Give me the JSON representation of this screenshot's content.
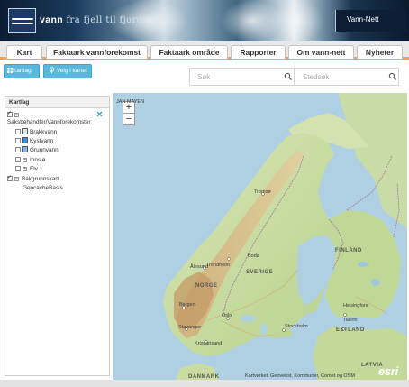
{
  "header": {
    "logo_text_bold": "vann",
    "logo_text_light": "fra fjell til fjord",
    "app_name": "Vann-Nett"
  },
  "tabs": [
    {
      "label": "Kart"
    },
    {
      "label": "Faktaark vannforekomst"
    },
    {
      "label": "Faktaark område"
    },
    {
      "label": "Rapporter"
    },
    {
      "label": "Om vann-nett"
    },
    {
      "label": "Nyheter"
    }
  ],
  "toolbar": {
    "kartlag_label": "Kartlag",
    "velg_label": "Velg i kartet",
    "search_placeholder": "Søk",
    "place_search_placeholder": "Stedsøk"
  },
  "layer_panel": {
    "title": "Kartlag",
    "group_label": "Saksbehandler/Vannforekomster",
    "items": [
      {
        "label": "Brakkvann",
        "color": "#cfeee0"
      },
      {
        "label": "Kystvann",
        "color": "#3d8fe0"
      },
      {
        "label": "Grunnvann",
        "color": "#7fb5e8"
      },
      {
        "label": "Innsjø"
      },
      {
        "label": "Elv"
      }
    ],
    "basemap_group": "Bakgrunnskart",
    "basemap_item": "GeocacheBasis"
  },
  "map": {
    "zoom_in": "+",
    "zoom_out": "−",
    "labels": {
      "jan_mayen": "JAN MAYEN",
      "finland": "FINLAND",
      "sverige": "SVERIGE",
      "norge": "NORGE",
      "estland": "ESTLAND",
      "latvia": "LATVIA",
      "danmark": "DANMARK",
      "tromso": "Tromsø",
      "bodo": "Bodø",
      "trondheim": "Trondheim",
      "alesund": "Ålesund",
      "bergen": "Bergen",
      "oslo": "Oslo",
      "stavanger": "Stavanger",
      "kristiansand": "Kristiansand",
      "stockholm": "Stockholm",
      "helsinki": "Helsingfors",
      "tallinn": "Tallinn"
    },
    "attribution": "Kartverket, Geovekst, Kommuner, Comet og OSM",
    "provider_logo": "esri"
  }
}
